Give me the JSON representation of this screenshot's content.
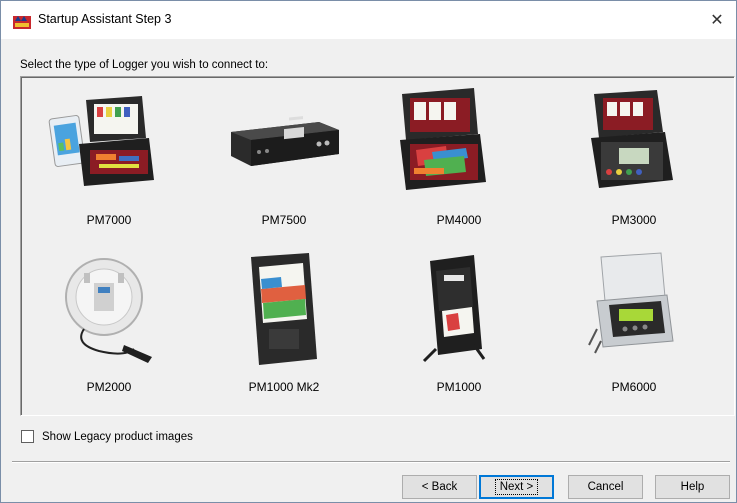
{
  "window": {
    "title": "Startup Assistant Step 3",
    "close_symbol": "✕"
  },
  "prompt": "Select the type of Logger you wish to connect to:",
  "loggers": [
    {
      "label": "PM7000",
      "icon": "pm7000-device-image"
    },
    {
      "label": "PM7500",
      "icon": "pm7500-device-image"
    },
    {
      "label": "PM4000",
      "icon": "pm4000-device-image"
    },
    {
      "label": "PM3000",
      "icon": "pm3000-device-image"
    },
    {
      "label": "PM2000",
      "icon": "pm2000-device-image"
    },
    {
      "label": "PM1000 Mk2",
      "icon": "pm1000mk2-device-image"
    },
    {
      "label": "PM1000",
      "icon": "pm1000-device-image"
    },
    {
      "label": "PM6000",
      "icon": "pm6000-device-image"
    }
  ],
  "legacy_checkbox": {
    "label": "Show Legacy product images",
    "checked": false
  },
  "buttons": {
    "back": "< Back",
    "next": "Next >",
    "cancel": "Cancel",
    "help": "Help"
  },
  "colors": {
    "accent": "#0078d7",
    "case_red": "#8b1c24",
    "case_black": "#2a2a2a"
  }
}
